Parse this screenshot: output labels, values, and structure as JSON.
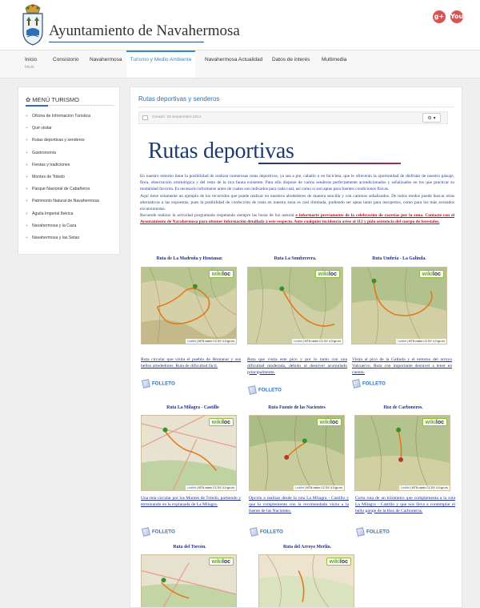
{
  "header": {
    "site_title": "Ayuntamiento de Navahermosa",
    "social": [
      {
        "name": "google-plus-icon",
        "label": "g+"
      },
      {
        "name": "youtube-icon",
        "label": "You"
      }
    ]
  },
  "nav": {
    "items": [
      {
        "label": "Inicio",
        "sub": "Inicio"
      },
      {
        "label": "Consistorio"
      },
      {
        "label": "Navahermosa"
      },
      {
        "label": "Turismo y Medio Ambiente"
      },
      {
        "label": "Navahermosa Actualidad"
      },
      {
        "label": "Datos de interés"
      },
      {
        "label": "Multimedia"
      }
    ],
    "active_index": 3
  },
  "sidebar": {
    "title": "MENÚ TURISMO",
    "items": [
      "Oficina de Información Turística",
      "Qué visitar",
      "Rutas deportivas y senderos",
      "Gastronomía",
      "Fiestas y tradiciones",
      "Montes de Toledo",
      "Parque Nacional de Cabañeros",
      "Patrimonio Natural de Navahermosa",
      "Águila Imperial Ibérica",
      "Navahermosa y la Caza",
      "Navahermosa y las Setas"
    ]
  },
  "article": {
    "title": "Rutas deportivas y senderos",
    "created": "Creado: 26 Septiembre 2014",
    "tools_label": "⚙ ▾",
    "banner": "Rutas deportivas",
    "intro_p1": "En nuestro entorno tiene la posibilidad de realizar numerosas rutas deportivas, ya sea a pie, caballo o en bicicleta, que le ofrecerán la oportunidad de disfrutar de nuestro paisaje, flora, observación ornitológica y del resto de la rica fauna existente. Para ello dispone de varios senderos perfectamente acondicionados y señalizados en los que practicar su modalidad favorita. Es necesario informarse antes de cuales son indicados para cada cual, así como si son aptas para fuentes condiciones físicas.",
    "intro_p2": "Aquí tiene solamente un ejemplo de los recorridos que puede realizar en nuestros alrededores de manera sencilla y con caminos señalizados. De todos modos puede buscar otras alternativas a las expuestas, pues la posibilidad de confección de rutas en nuestra zona es casi ilimitada, pudiendo ser aptas tanto para inexpertos, como para los más avezados excursionistas.",
    "intro_p3": "Recuerde realizar la actividad programada respetando siempre las horas de luz natural",
    "intro_red": "e informarte previamente de la celebración de cacerías por la zona. Contacte con el Ayuntamiento de Navahermosa para obtener información detallada a este respecto.  Ante cualquier incidencia avise al 112 y pida asistencia del cuerpo de forestales.",
    "folleto_label": "FOLLETO",
    "map_attr_leaflet": "Leaflet",
    "map_attr_rest": "| MTN raster CC BY 4.0 ign.es",
    "wikiloc_label": "wikiloc",
    "routes": [
      {
        "title": "Ruta de La Madroña y Hontanar.",
        "desc": "Ruta circular que visita el pueblo de Hontanar y sus bellos alrededores. Ruta de dificultad fácil."
      },
      {
        "title": "Ruta La Sombrerera.",
        "desc": "Ruta que visita este pico y por lo tanto con una dificultad moderada, debido al desnivel acumulado principalmente."
      },
      {
        "title": "Ruta Umbría - La Galinda.",
        "desc": "Visita al pico de la Galinda y el entorno del arroyo Valcuervo. Ruta con importante desnivel a tener en cuenta."
      },
      {
        "title": "Ruta La Milagra - Castillo",
        "desc": "Una ruta circular por los Montes de Toledo, partiendo y terminando en la explanada de La Milagra."
      },
      {
        "title": "Ruta Fuente de las Nacientes",
        "desc": "Opción a realizar desde la ruta La Milagra - Castillo y que la complementa con la recomendada visita a la fuente de las Nacientes."
      },
      {
        "title": "Hoz de Carboneros.",
        "desc": "Corta ruta de un kilómetro que complementa a la ruta La Milagra - Castillo y que nos lleva a contemplar el bello paraje de la Hoz de Carboneros."
      },
      {
        "title": "Ruta del Torcón."
      },
      {
        "title": "Ruta del Arroyo Merlín."
      }
    ]
  }
}
